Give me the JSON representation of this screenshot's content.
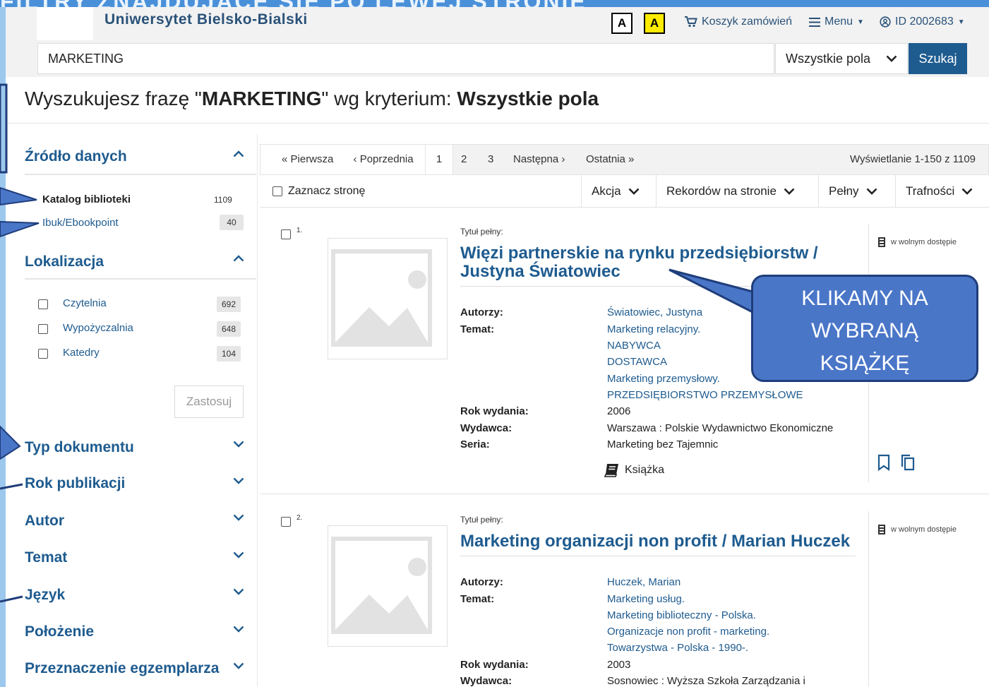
{
  "banner": {
    "slogan": "FILTRY ZNAJDUJĄCE SIĘ PO LEWEJ STRONIE"
  },
  "header": {
    "university": "Uniwersytet Bielsko-Bialski",
    "contrast_normal": "A",
    "contrast_high": "A",
    "cart": "Koszyk zamówień",
    "menu": "Menu",
    "user_id": "ID 2002683"
  },
  "search": {
    "query": "MARKETING",
    "field": "Wszystkie pola",
    "button": "Szukaj"
  },
  "heading": {
    "prefix": "Wyszukujesz frazę \"",
    "phrase": "MARKETING",
    "middle": "\" wg kryterium: ",
    "criterion": "Wszystkie pola"
  },
  "facets": {
    "source": {
      "title": "Źródło danych",
      "items": [
        {
          "label": "Katalog biblioteki",
          "count": "1109"
        },
        {
          "label": "Ibuk/Ebookpoint",
          "count": "40"
        }
      ]
    },
    "location": {
      "title": "Lokalizacja",
      "items": [
        {
          "label": "Czytelnia",
          "count": "692"
        },
        {
          "label": "Wypożyczalnia",
          "count": "648"
        },
        {
          "label": "Katedry",
          "count": "104"
        }
      ],
      "apply": "Zastosuj"
    },
    "collapsed": [
      "Typ dokumentu",
      "Rok publikacji",
      "Autor",
      "Temat",
      "Język",
      "Położenie",
      "Przeznaczenie egzemplarza"
    ]
  },
  "pager": {
    "first": "« Pierwsza",
    "prev": "‹ Poprzednia",
    "pages": [
      "1",
      "2",
      "3"
    ],
    "next": "Następna ›",
    "last": "Ostatnia »",
    "info": "Wyświetlanie 1-150 z 1109"
  },
  "toolbar": {
    "select_page": "Zaznacz stronę",
    "action": "Akcja",
    "per_page": "Rekordów na stronie",
    "view": "Pełny",
    "sort": "Trafności"
  },
  "records": [
    {
      "num": "1.",
      "title_label": "Tytuł pełny:",
      "title": "Więzi partnerskie na rynku przedsiębiorstw / Justyna Światowiec",
      "access": "w wolnym dostępie",
      "authors_label": "Autorzy:",
      "authors": "Światowiec, Justyna",
      "subject_label": "Temat:",
      "subjects": [
        "Marketing relacyjny.",
        "NABYWCA",
        "DOSTAWCA",
        "Marketing przemysłowy.",
        "PRZEDSIĘBIORSTWO PRZEMYSŁOWE"
      ],
      "year_label": "Rok wydania:",
      "year": "2006",
      "publisher_label": "Wydawca:",
      "publisher": "Warszawa : Polskie Wydawnictwo Ekonomiczne",
      "series_label": "Seria:",
      "series": "Marketing bez Tajemnic",
      "doc_type": "Książka"
    },
    {
      "num": "2.",
      "title_label": "Tytuł pełny:",
      "title": "Marketing organizacji non profit / Marian Huczek",
      "access": "w wolnym dostępie",
      "authors_label": "Autorzy:",
      "authors": "Huczek, Marian",
      "subject_label": "Temat:",
      "subjects": [
        "Marketing usług.",
        "Marketing biblioteczny - Polska.",
        "Organizacje non profit - marketing.",
        "Towarzystwa - Polska - 1990-."
      ],
      "year_label": "Rok wydania:",
      "year": "2003",
      "publisher_label": "Wydawca:",
      "publisher": "Sosnowiec : Wyższa Szkoła Zarządzania i"
    }
  ],
  "callout": {
    "lines": [
      "KLIKAMY NA",
      "WYBRANĄ",
      "KSIĄŻKĘ"
    ]
  },
  "colors": {
    "link": "#1e5b8f",
    "search_button": "#1e5b8f",
    "callout": "#4a76c8",
    "callout_border": "#1f3d7a",
    "contrast_high": "#ffeb00"
  },
  "icons": [
    "cart-icon",
    "hamburger-icon",
    "user-id-icon",
    "chevron-down-icon",
    "chevron-up-icon",
    "image-placeholder-icon",
    "building-icon",
    "bookmark-icon",
    "copy-icon",
    "book-icon"
  ]
}
